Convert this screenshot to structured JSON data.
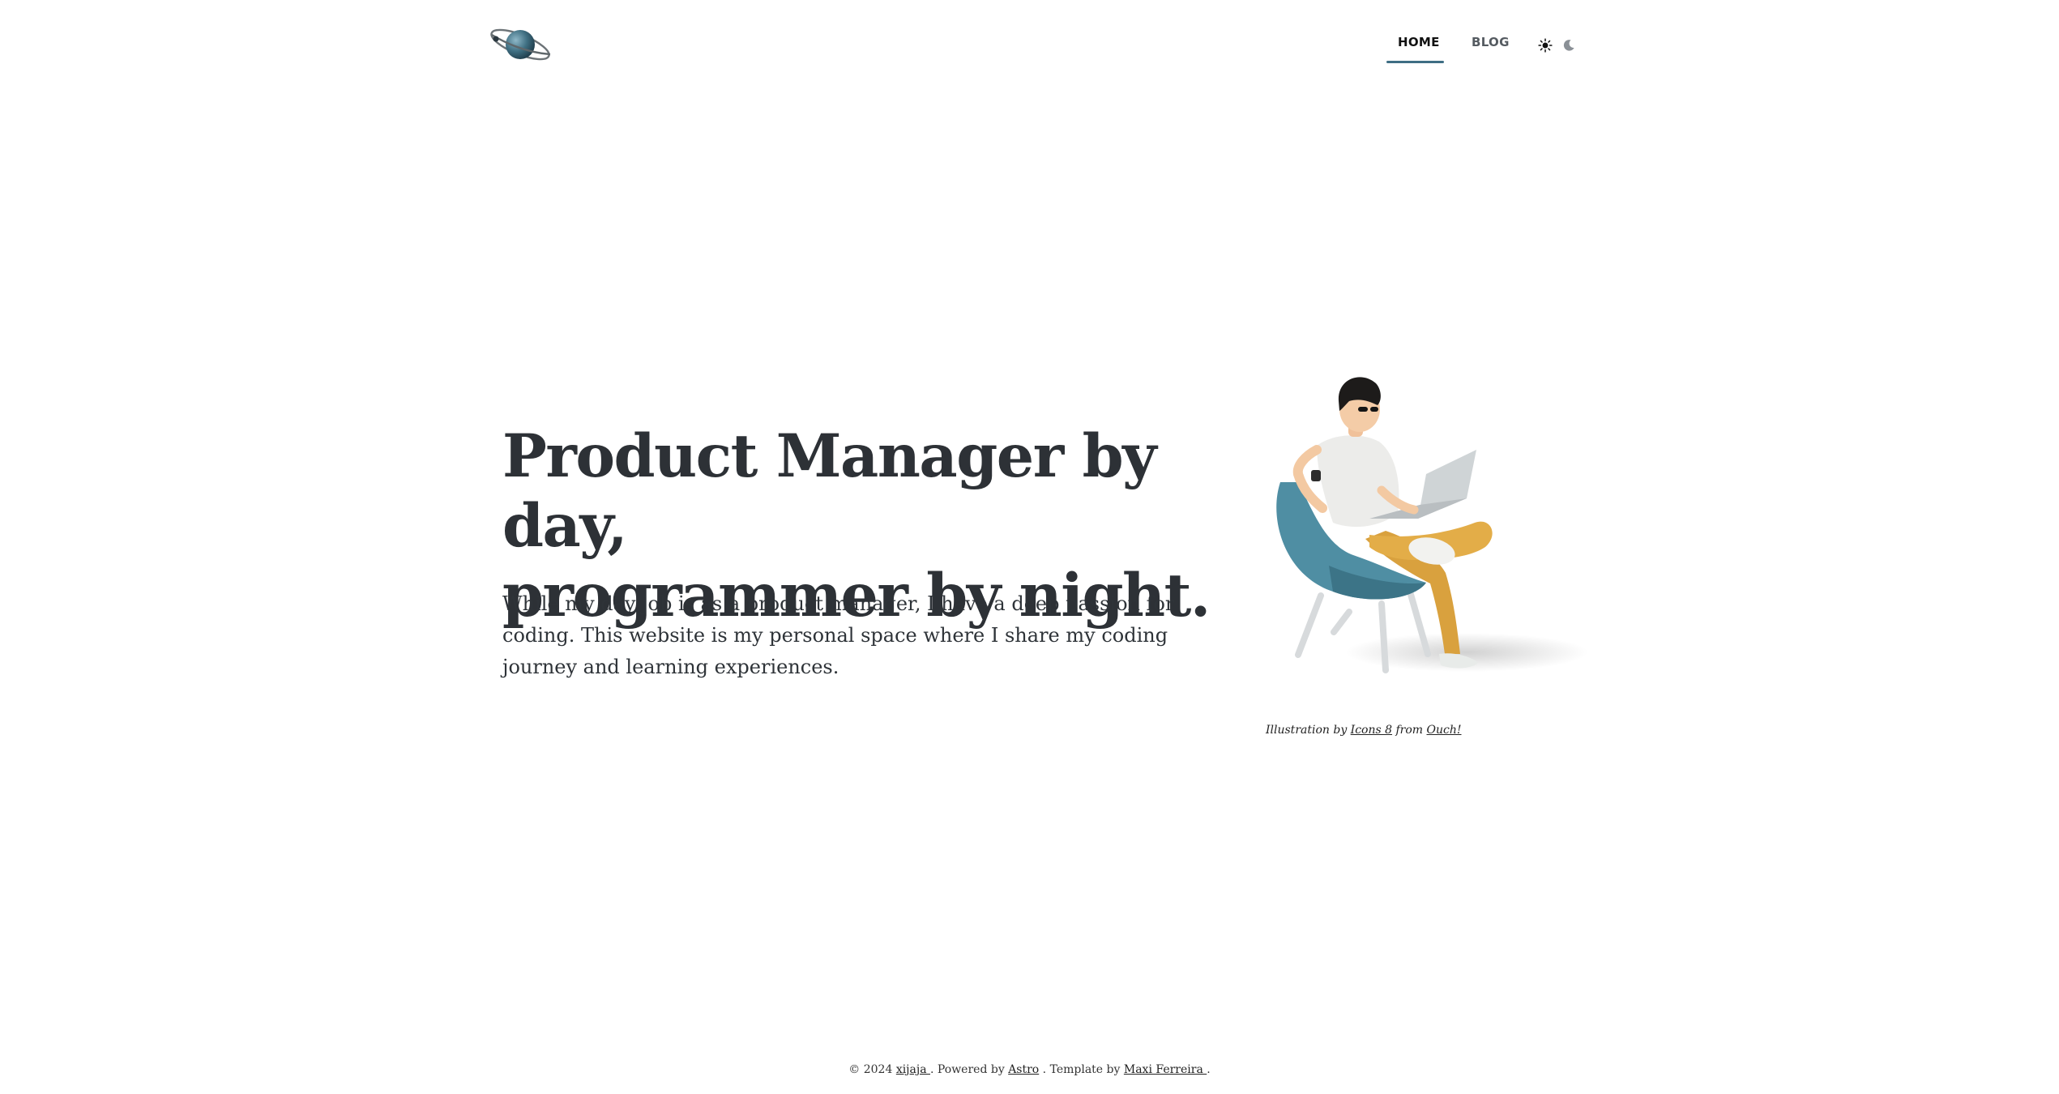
{
  "nav": {
    "home_label": "HOME",
    "blog_label": "BLOG",
    "sun_icon": "sun-icon",
    "moon_icon": "moon-icon",
    "active_color": "#3e6e84"
  },
  "logo": {
    "icon": "planet-icon"
  },
  "hero": {
    "title_line1": "Product Manager by day,",
    "title_line2": "programmer by night.",
    "description": "While my day job is as a product manager, I have a deep passion for coding. This website is my personal space where I share my coding journey and learning experiences."
  },
  "illustration": {
    "caption_prefix": "Illustration by ",
    "caption_author": "Icons 8",
    "caption_middle": " from ",
    "caption_source": "Ouch!"
  },
  "footer": {
    "copyright": "© 2024 ",
    "author_link": "xijaja ",
    "powered_text": ". Powered by ",
    "powered_link": "Astro",
    "template_text": " . Template by ",
    "template_link": "Maxi Ferreira ",
    "end": "."
  }
}
